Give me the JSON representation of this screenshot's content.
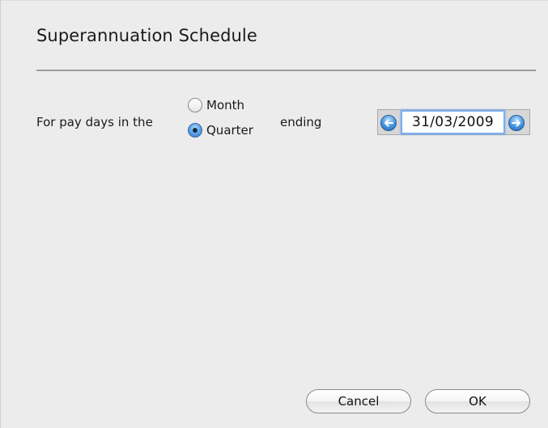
{
  "dialog": {
    "title": "Superannuation Schedule"
  },
  "form": {
    "prefix_label": "For pay days in the",
    "period_options": [
      {
        "label": "Month",
        "selected": false
      },
      {
        "label": "Quarter",
        "selected": true
      }
    ],
    "ending_label": "ending",
    "date_value": "31/03/2009"
  },
  "buttons": {
    "cancel_label": "Cancel",
    "ok_label": "OK"
  },
  "colors": {
    "background": "#ececec",
    "accent": "#4b9be4",
    "focus_ring": "#7aaef0"
  }
}
